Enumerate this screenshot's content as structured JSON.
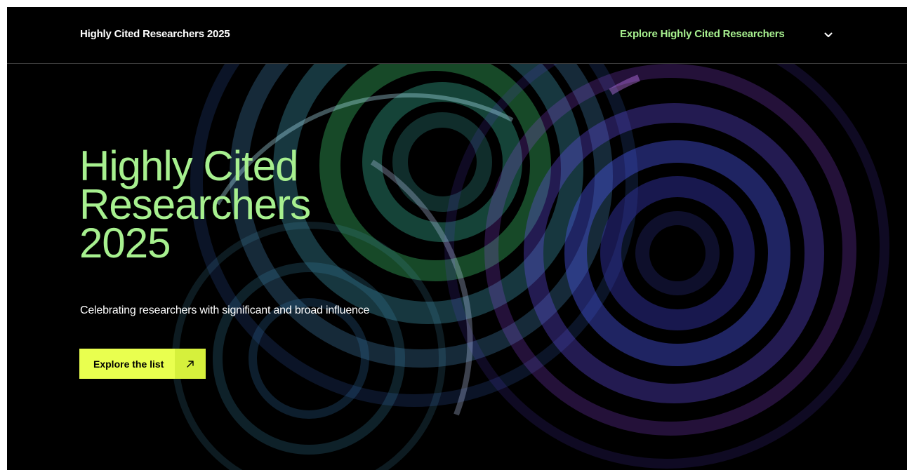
{
  "header": {
    "site_title": "Highly Cited Researchers 2025",
    "nav_label": "Explore Highly Cited Researchers",
    "menu_icon": "chevron-down-icon"
  },
  "hero": {
    "title_line1": "Highly Cited",
    "title_line2": "Researchers",
    "title_line3": "2025",
    "subtitle": "Celebrating researchers with significant and broad influence",
    "cta_label": "Explore the list",
    "cta_icon": "arrow-up-right-icon"
  },
  "colors": {
    "background": "#000000",
    "accent_green": "#a7f08f",
    "cta_yellow": "#e9ff4f",
    "art_green": "#3fbf6a",
    "art_blue": "#4a56e8",
    "art_violet": "#9a4df0"
  }
}
